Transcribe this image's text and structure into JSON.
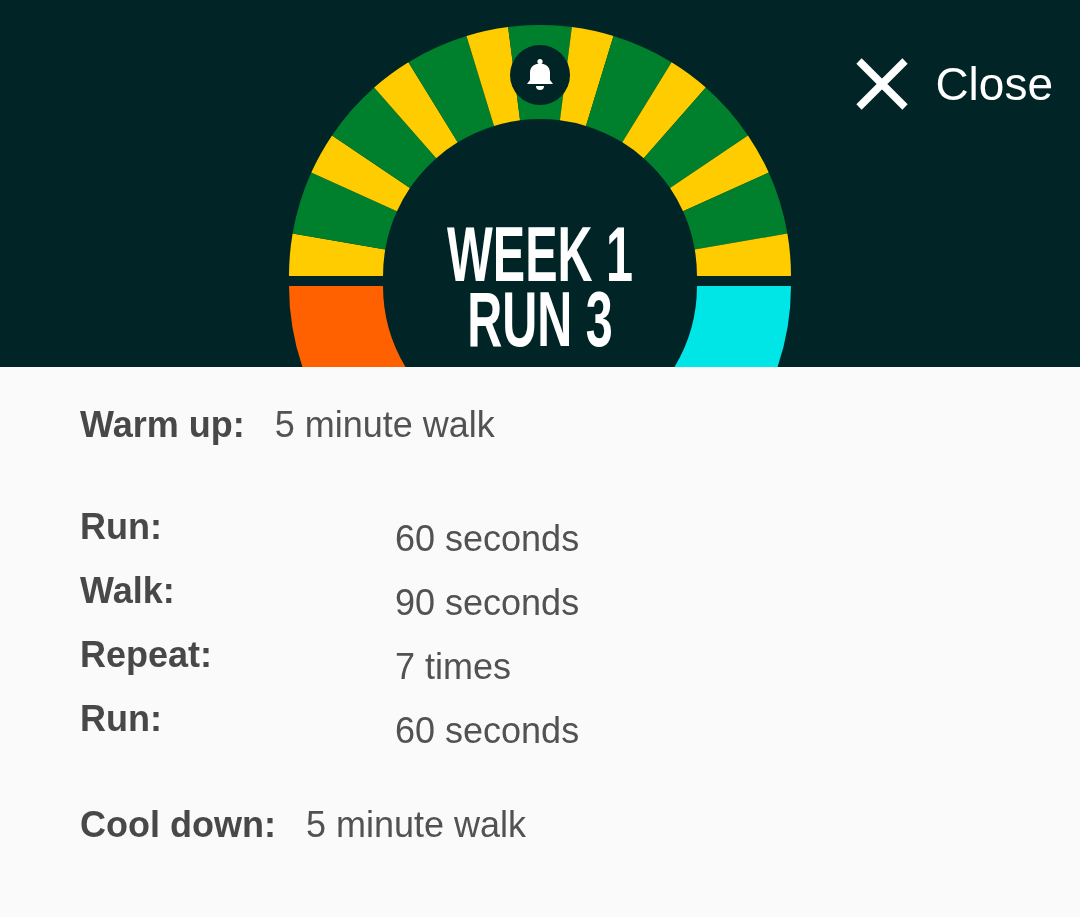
{
  "header": {
    "title": "WEEK 1 RUN 3",
    "close_button": {
      "label": "Close"
    }
  },
  "schedule": {
    "warm_up": {
      "label": "Warm up:",
      "value": "5 minute walk"
    },
    "intervals": [
      {
        "label": "Run:",
        "value": "60 seconds"
      },
      {
        "label": "Walk:",
        "value": "90 seconds"
      },
      {
        "label": "Repeat:",
        "value": "7 times"
      },
      {
        "label": "Run:",
        "value": "60 seconds"
      }
    ],
    "cool_down": {
      "label": "Cool down:",
      "value": "5 minute walk"
    }
  }
}
